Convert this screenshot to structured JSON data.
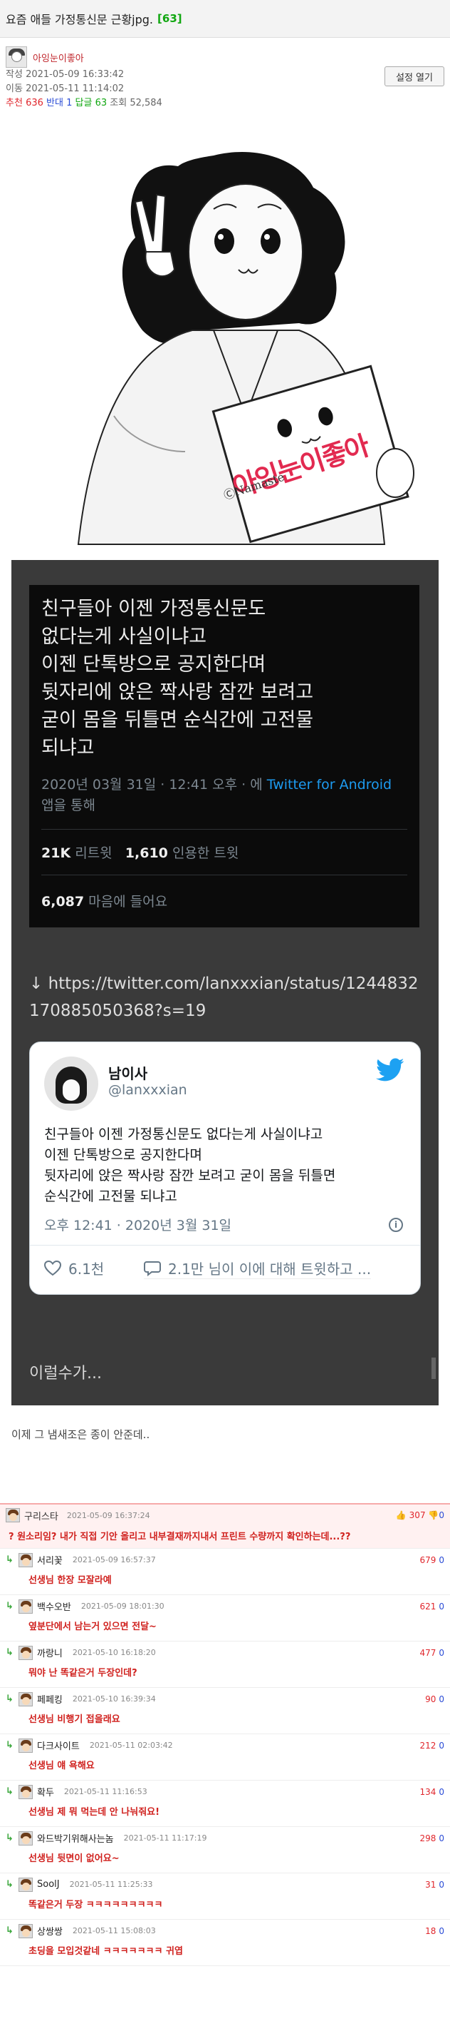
{
  "post": {
    "title": "요즘 애들 가정통신문 근황jpg.",
    "comment_count": "[63]",
    "author": "아잉눈이좋아",
    "written_label": "작성",
    "written": "2021-05-09 16:33:42",
    "moved_label": "이동",
    "moved": "2021-05-11 11:14:02",
    "rec_label": "추천",
    "rec": "636",
    "opp_label": "반대",
    "opp": "1",
    "reply_label": "답글",
    "reply": "63",
    "views_label": "조회",
    "views": "52,584",
    "settings_label": "설정 열기"
  },
  "illustration": {
    "sign_text": "아잉눈이좋아",
    "sign_sub": "ⒸNamaste"
  },
  "tweet_image": {
    "text": "친구들아 이젠 가정통신문도\n없다는게 사실이냐고\n이젠 단톡방으로 공지한다며\n뒷자리에 앉은 짝사랑 잠깐 보려고\n굳이 몸을 뒤틀면 순식간에 고전물\n되냐고",
    "date_prefix": "2020년 03월 31일 · 12:41 오후 · 에",
    "date_link": "Twitter for Android",
    "date_suffix": "앱을 통해",
    "retweets": "21K",
    "retweets_label": "리트윗",
    "quotes": "1,610",
    "quotes_label": "인용한 트윗",
    "likes": "6,087",
    "likes_label": "마음에 들어요"
  },
  "link": "↓ https://twitter.com/lanxxxian/status/1244832170885050368?s=19",
  "card": {
    "name": "남이사",
    "handle": "@lanxxxian",
    "body": "친구들아 이젠 가정통신문도 없다는게 사실이냐고\n이젠 단톡방으로 공지한다며\n뒷자리에 앉은 짝사랑 잠깐 보려고 굳이 몸을 뒤틀면\n순식간에 고전물 되냐고",
    "when": "오후 12:41 · 2020년 3월 31일",
    "likes": "6.1천",
    "replies": "2.1만 님이 이에 대해 트윗하고 ..."
  },
  "more_text": "이럴수가...",
  "footer_text": "이제 그 냄새조은 종이 안준데..",
  "comments": {
    "main": {
      "nick": "구리스타",
      "date": "2021-05-09 16:37:24",
      "up": "307",
      "down": "0",
      "text": "? 원소리임? 내가 직접 기안 올리고 내부결재까지내서 프린트 수량까지 확인하는데...??"
    },
    "replies": [
      {
        "nick": "서리꽃",
        "date": "2021-05-09 16:57:37",
        "up": "679",
        "down": "0",
        "text": "선생님 한장 모잘라예"
      },
      {
        "nick": "백수오반",
        "date": "2021-05-09 18:01:30",
        "up": "621",
        "down": "0",
        "text": "옆분단에서 남는거 있으면 전달~"
      },
      {
        "nick": "까랑니",
        "date": "2021-05-10 16:18:20",
        "up": "477",
        "down": "0",
        "text": "뭐야 난 똑같은거 두장인데?"
      },
      {
        "nick": "페페킹",
        "date": "2021-05-10 16:39:34",
        "up": "90",
        "down": "0",
        "text": "선생님 비행기 접을래요"
      },
      {
        "nick": "다크사이트",
        "date": "2021-05-11 02:03:42",
        "up": "212",
        "down": "0",
        "text": "선생님 얘 욕해요"
      },
      {
        "nick": "확두",
        "date": "2021-05-11 11:16:53",
        "up": "134",
        "down": "0",
        "text": "선생님 제 뭐 먹는데 안 나눠줘요!"
      },
      {
        "nick": "와드박기위해사는놈",
        "date": "2021-05-11 11:17:19",
        "up": "298",
        "down": "0",
        "text": "선생님 뒷면이 없어요~"
      },
      {
        "nick": "SoolJ",
        "date": "2021-05-11 11:25:33",
        "up": "31",
        "down": "0",
        "text": "똑같은거 두장 ㅋㅋㅋㅋㅋㅋㅋㅋㅋ"
      },
      {
        "nick": "상쌍쌍",
        "date": "2021-05-11 15:08:03",
        "up": "18",
        "down": "0",
        "text": "초딩을 모입것같네 ㅋㅋㅋㅋㅋㅋㅋ 귀엽"
      }
    ]
  }
}
